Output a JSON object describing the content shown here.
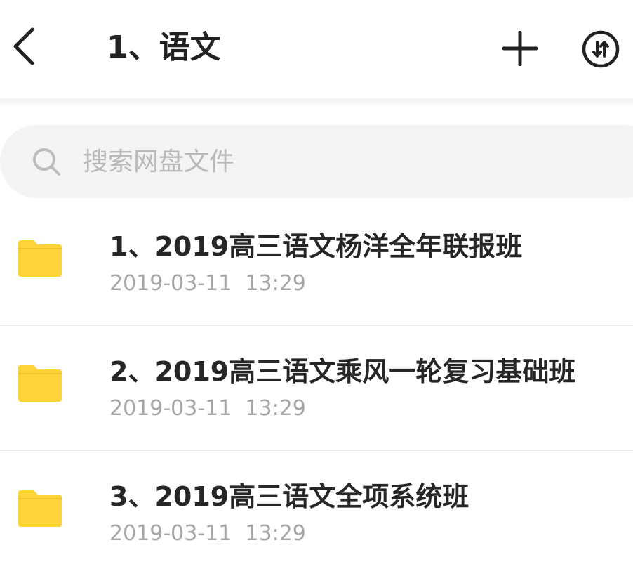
{
  "header": {
    "title": "1、语文",
    "back_icon": "chevron-left-icon",
    "add_icon": "plus-icon",
    "sort_icon": "sort-arrows-icon"
  },
  "search": {
    "placeholder": "搜索网盘文件",
    "icon": "search-icon"
  },
  "files": [
    {
      "name": "1、2019高三语文杨洋全年联报班",
      "date": "2019-03-11  13:29",
      "icon": "folder-icon"
    },
    {
      "name": "2、2019高三语文乘风一轮复习基础班",
      "date": "2019-03-11  13:29",
      "icon": "folder-icon"
    },
    {
      "name": "3、2019高三语文全项系统班",
      "date": "2019-03-11  13:29",
      "icon": "folder-icon"
    }
  ],
  "colors": {
    "folder": "#FFD33A",
    "search_bg": "#F4F4F4",
    "date_text": "#A6A6A6",
    "title_text": "#222222"
  }
}
